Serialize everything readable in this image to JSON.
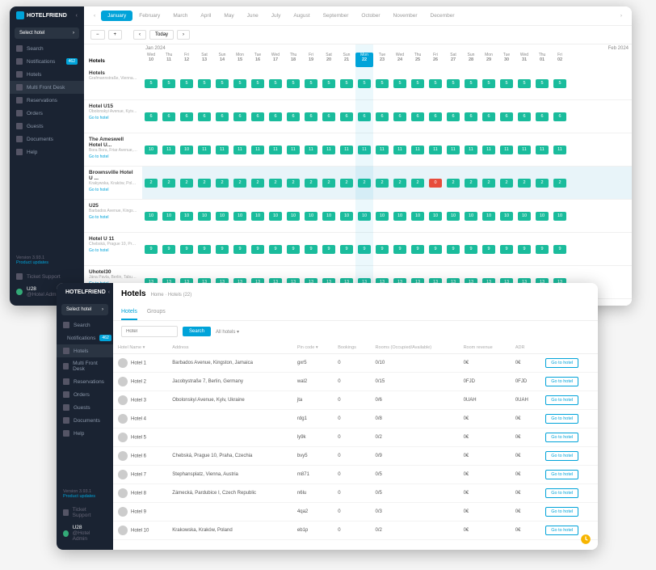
{
  "brand": "HOTELFRIEND",
  "select_hotel": "Select hotel",
  "nav": [
    {
      "label": "Search",
      "badge": ""
    },
    {
      "label": "Notifications",
      "badge": "462"
    },
    {
      "label": "Hotels",
      "badge": ""
    },
    {
      "label": "Multi Front Desk",
      "badge": "",
      "active": true
    },
    {
      "label": "Reservations",
      "badge": ""
    },
    {
      "label": "Orders",
      "badge": ""
    },
    {
      "label": "Guests",
      "badge": ""
    },
    {
      "label": "Documents",
      "badge": ""
    },
    {
      "label": "Help",
      "badge": ""
    }
  ],
  "version": "Version 3.93.1",
  "product_updates": "Product updates",
  "ticket_support": "Ticket Support",
  "user": {
    "name": "U28",
    "sub": "@Hotel Admin"
  },
  "months": [
    "January",
    "February",
    "March",
    "April",
    "May",
    "June",
    "July",
    "August",
    "September",
    "October",
    "November",
    "December"
  ],
  "active_month": 0,
  "toolbar": {
    "today": "Today",
    "minus": "−",
    "plus": "+",
    "prev": "‹",
    "next": "›"
  },
  "cal": {
    "label1": "Jan 2024",
    "label2": "Feb 2024",
    "days": [
      [
        "Wed",
        "10"
      ],
      [
        "Thu",
        "11"
      ],
      [
        "Fri",
        "12"
      ],
      [
        "Sat",
        "13"
      ],
      [
        "Sun",
        "14"
      ],
      [
        "Mon",
        "15"
      ],
      [
        "Tue",
        "16"
      ],
      [
        "Wed",
        "17"
      ],
      [
        "Thu",
        "18"
      ],
      [
        "Fri",
        "19"
      ],
      [
        "Sat",
        "20"
      ],
      [
        "Sun",
        "21"
      ],
      [
        "Mon",
        "22"
      ],
      [
        "Tue",
        "23"
      ],
      [
        "Wed",
        "24"
      ],
      [
        "Thu",
        "25"
      ],
      [
        "Fri",
        "26"
      ],
      [
        "Sat",
        "27"
      ],
      [
        "Sun",
        "28"
      ],
      [
        "Mon",
        "29"
      ],
      [
        "Tue",
        "30"
      ],
      [
        "Wed",
        "31"
      ],
      [
        "Thu",
        "01"
      ],
      [
        "Fri",
        "02"
      ]
    ],
    "cur": 12
  },
  "hotels_col": "Hotels",
  "goto": "Go to hotel",
  "rows": [
    {
      "name": "Hotels",
      "addr": "Grafmannstraße, Vienna, A...",
      "vals": [
        5,
        5,
        5,
        5,
        5,
        5,
        5,
        5,
        5,
        5,
        5,
        5,
        5,
        5,
        5,
        5,
        5,
        5,
        5,
        5,
        5,
        5,
        5,
        5
      ],
      "header": true
    },
    {
      "name": "Hotel U15",
      "addr": "Obolonskyi Avenue, Kyiv, ...",
      "vals": [
        6,
        6,
        6,
        6,
        6,
        6,
        6,
        6,
        6,
        6,
        6,
        6,
        6,
        6,
        6,
        6,
        6,
        6,
        6,
        6,
        6,
        6,
        6,
        6
      ]
    },
    {
      "name": "The Ameswell Hotel U...",
      "addr": "Bora Bora, Friar Avenue, ...",
      "vals": [
        10,
        11,
        10,
        11,
        11,
        11,
        11,
        11,
        11,
        11,
        11,
        11,
        11,
        11,
        11,
        11,
        11,
        11,
        11,
        11,
        11,
        11,
        11,
        11
      ]
    },
    {
      "name": "Brownsville Hotel U ...",
      "addr": "Krakywska, Kraków, Poland",
      "vals": [
        2,
        2,
        2,
        2,
        2,
        2,
        2,
        2,
        2,
        2,
        2,
        2,
        2,
        2,
        2,
        2,
        0,
        2,
        2,
        2,
        2,
        2,
        2,
        2
      ],
      "hl": true,
      "red": 16
    },
    {
      "name": "U25",
      "addr": "Barbados Avenue, Kingston, ...",
      "vals": [
        10,
        10,
        10,
        10,
        10,
        10,
        10,
        10,
        10,
        10,
        10,
        10,
        10,
        10,
        10,
        10,
        10,
        10,
        10,
        10,
        10,
        10,
        10,
        10
      ]
    },
    {
      "name": "Hotel U 11",
      "addr": "Chebská, Prague 10, Praha, ...",
      "vals": [
        9,
        9,
        9,
        9,
        9,
        9,
        9,
        9,
        9,
        9,
        9,
        9,
        9,
        9,
        9,
        9,
        9,
        9,
        9,
        9,
        9,
        9,
        9,
        9
      ]
    },
    {
      "name": "Uhotel30",
      "addr": "Jána Pavla, Berlin, Tabu, ...",
      "vals": [
        13,
        13,
        13,
        13,
        13,
        13,
        13,
        13,
        13,
        13,
        13,
        13,
        13,
        13,
        13,
        13,
        13,
        13,
        13,
        13,
        13,
        13,
        13,
        13
      ]
    }
  ],
  "win2": {
    "title": "Hotels",
    "breadcrumb": "Home · Hotels (22)",
    "tabs": [
      "Hotels",
      "Groups"
    ],
    "active_tab": 0,
    "search_ph": "Hotel",
    "search_btn": "Search",
    "filter": "All hotels ▾",
    "cols": [
      "Hotel Name ▾",
      "Address",
      "Pin code ▾",
      "Bookings",
      "Rooms (Occupied/Available)",
      "Room revenue",
      "ADR",
      ""
    ],
    "goto": "Go to hotel",
    "rows": [
      {
        "n": "Hotel 1",
        "a": "Barbados Avenue, Kingston, Jamaica",
        "p": "gxr5",
        "b": "0",
        "r": "0/10",
        "rev": "0€",
        "adr": "0€"
      },
      {
        "n": "Hotel 2",
        "a": "Jacobystraße 7, Berlin, Germany",
        "p": "wal2",
        "b": "0",
        "r": "0/15",
        "rev": "0FJD",
        "adr": "0FJD"
      },
      {
        "n": "Hotel 3",
        "a": "Obolonskyi Avenue, Kyiv, Ukraine",
        "p": "jta",
        "b": "0",
        "r": "0/6",
        "rev": "0UAH",
        "adr": "0UAH"
      },
      {
        "n": "Hotel 4",
        "a": "",
        "p": "rdg1",
        "b": "0",
        "r": "0/8",
        "rev": "0€",
        "adr": "0€"
      },
      {
        "n": "Hotel 5",
        "a": "",
        "p": "ly9k",
        "b": "0",
        "r": "0/2",
        "rev": "0€",
        "adr": "0€"
      },
      {
        "n": "Hotel 6",
        "a": "Chebská, Prague 10, Praha, Czechia",
        "p": "bvy5",
        "b": "0",
        "r": "0/9",
        "rev": "0€",
        "adr": "0€"
      },
      {
        "n": "Hotel 7",
        "a": "Stephansplatz, Vienna, Austria",
        "p": "m871",
        "b": "0",
        "r": "0/5",
        "rev": "0€",
        "adr": "0€"
      },
      {
        "n": "Hotel 8",
        "a": "Zámecká, Pardubice I, Czech Republic",
        "p": "n6lu",
        "b": "0",
        "r": "0/5",
        "rev": "0€",
        "adr": "0€"
      },
      {
        "n": "Hotel 9",
        "a": "",
        "p": "4qa2",
        "b": "0",
        "r": "0/3",
        "rev": "0€",
        "adr": "0€"
      },
      {
        "n": "Hotel 10",
        "a": "Krakowska, Kraków, Poland",
        "p": "eb1p",
        "b": "0",
        "r": "0/2",
        "rev": "0€",
        "adr": "0€"
      }
    ]
  }
}
